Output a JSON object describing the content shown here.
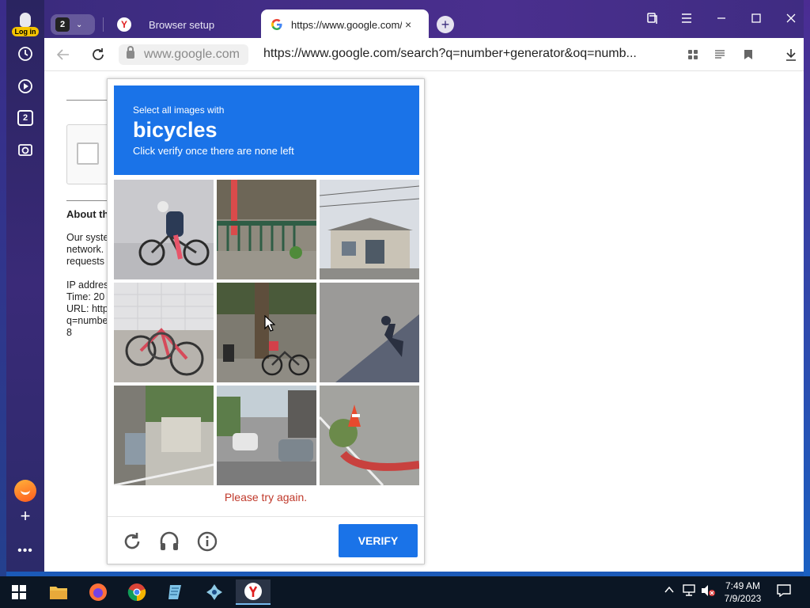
{
  "sidebar": {
    "login_badge": "Log in",
    "tabs_badge": "2"
  },
  "tabs": {
    "count": "2",
    "tab1_title": "Browser setup",
    "tab2_title": "https://www.google.com/search?q=number+generator",
    "tab2_close": "×",
    "new_tab": "+"
  },
  "addressbar": {
    "domain": "www.google.com",
    "url": "https://www.google.com/search?q=number+generator&oq=numb..."
  },
  "page": {
    "about_heading": "About th",
    "body_lines": [
      "Our syste",
      "network.",
      "requests"
    ],
    "info_lines": [
      "IP addres",
      "Time: 20",
      "URL: http",
      "q=numbe",
      "8"
    ]
  },
  "captcha": {
    "instruction_small": "Select all images with",
    "target": "bicycles",
    "instruction_sub": "Click verify once there are none left",
    "error": "Please try again.",
    "verify_label": "VERIFY"
  },
  "taskbar": {
    "time": "7:49 AM",
    "date": "7/9/2023"
  },
  "colors": {
    "captcha_blue": "#1a73e8",
    "error_red": "#c0392b",
    "browser_purple": "#3b2b7e"
  }
}
